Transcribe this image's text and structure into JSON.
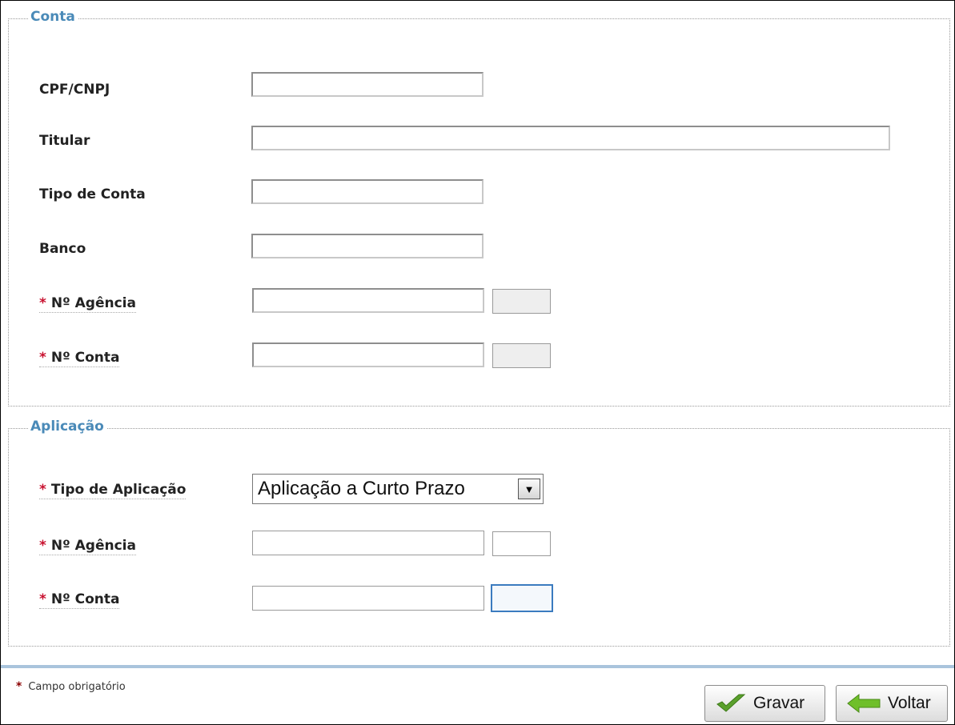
{
  "conta": {
    "legend": "Conta",
    "cpf_label": "CPF/CNPJ",
    "cpf_value": "",
    "titular_label": "Titular",
    "titular_value": "",
    "tipo_label": "Tipo de Conta",
    "tipo_value": "",
    "banco_label": "Banco",
    "banco_value": "",
    "agencia_label": "Nº Agência",
    "agencia_value": "",
    "agencia_dv": "",
    "conta_label": "Nº Conta",
    "conta_value": "",
    "conta_dv": ""
  },
  "aplicacao": {
    "legend": "Aplicação",
    "tipo_label": "Tipo de Aplicação",
    "tipo_selected": "Aplicação a Curto Prazo",
    "agencia_label": "Nº Agência",
    "agencia_value": "",
    "agencia_dv": "",
    "conta_label": "Nº Conta",
    "conta_value": "",
    "conta_dv": ""
  },
  "required_mark": "*",
  "footer": {
    "note": "Campo obrigatório",
    "save_label": "Gravar",
    "back_label": "Voltar"
  },
  "colors": {
    "legend": "#4a8ab8",
    "required": "#c8102e",
    "check_icon": "#5aa02c",
    "back_arrow": "#6fbf2a",
    "divider": "#a9c4dc"
  }
}
